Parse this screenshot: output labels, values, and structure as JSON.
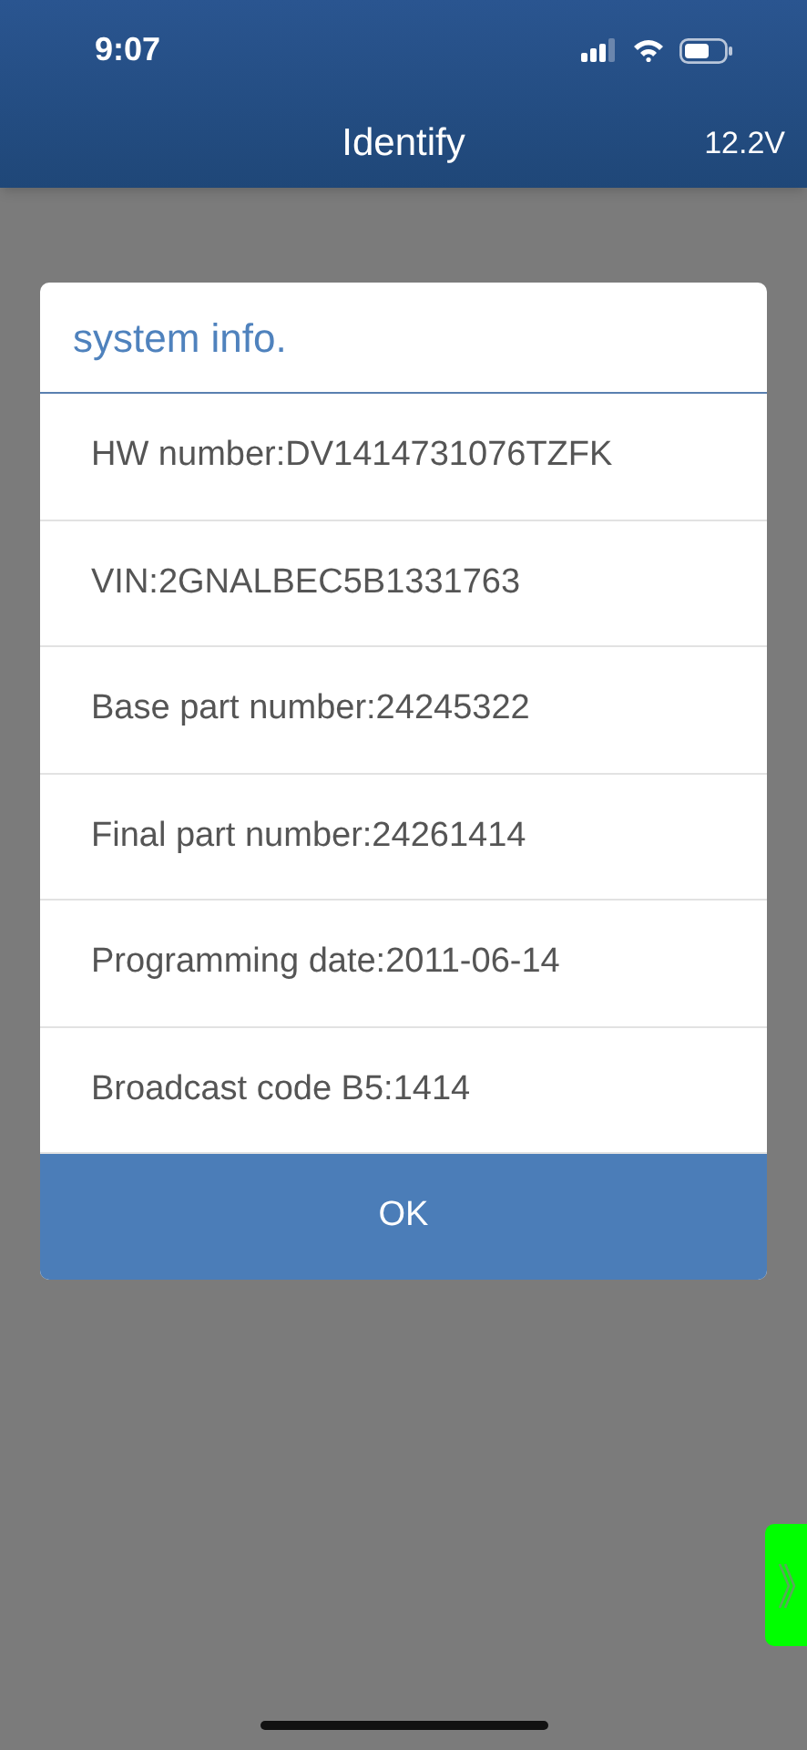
{
  "status_bar": {
    "time": "9:07"
  },
  "nav_bar": {
    "title": "Identify",
    "voltage": "12.2V"
  },
  "dialog": {
    "title": "system info.",
    "rows": [
      "HW number:DV1414731076TZFK",
      "VIN:2GNALBEC5B1331763",
      "Base part number:24245322",
      "Final part number:24261414",
      "Programming date:2011-06-14",
      "Broadcast code B5:1414"
    ],
    "button": "OK"
  }
}
